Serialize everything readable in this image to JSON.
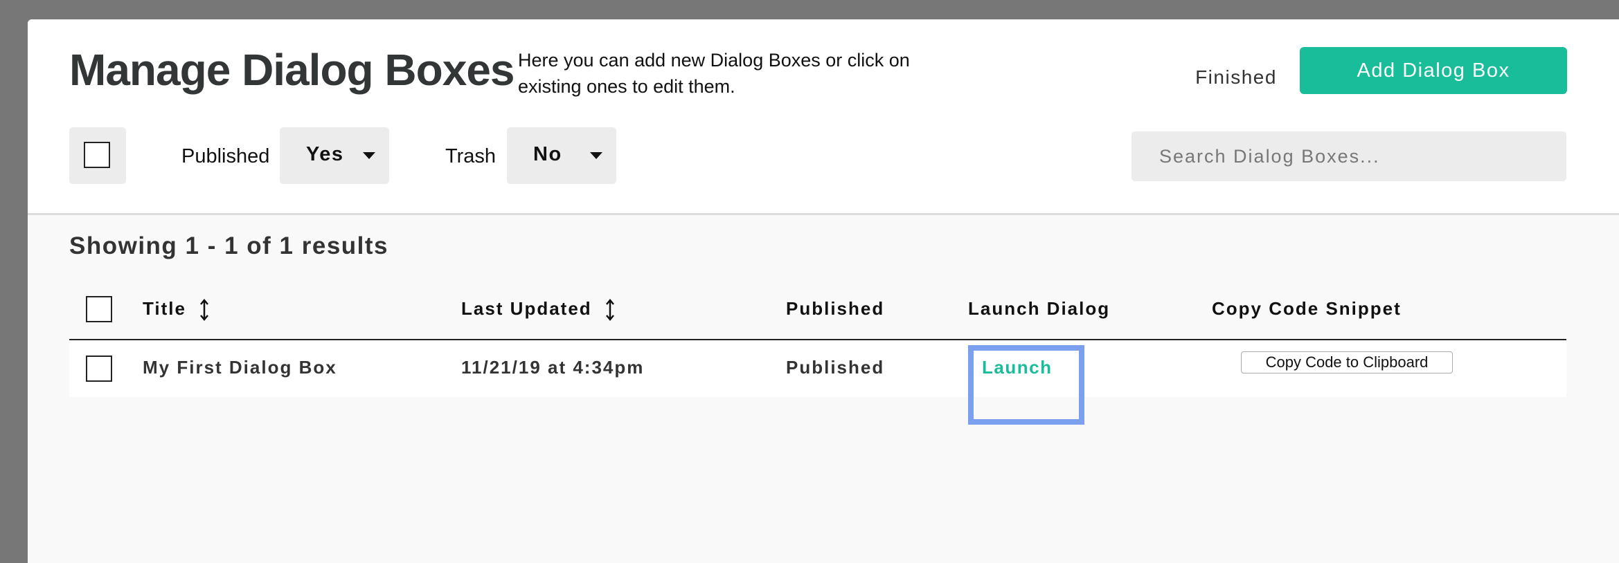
{
  "header": {
    "title": "Manage Dialog Boxes",
    "description": "Here you can add new Dialog Boxes or click on existing ones to edit them.",
    "finished_label": "Finished",
    "add_label": "Add Dialog Box"
  },
  "filters": {
    "published_label": "Published",
    "published_value": "Yes",
    "trash_label": "Trash",
    "trash_value": "No",
    "search_placeholder": "Search Dialog Boxes..."
  },
  "results": {
    "summary": "Showing 1 - 1 of 1 results"
  },
  "table": {
    "columns": [
      "Title",
      "Last Updated",
      "Published",
      "Launch Dialog",
      "Copy Code Snippet"
    ],
    "rows": [
      {
        "title": "My First Dialog Box",
        "last_updated": "11/21/19 at 4:34pm",
        "published": "Published",
        "launch": "Launch",
        "copy": "Copy Code to Clipboard"
      }
    ]
  },
  "colors": {
    "accent": "#19bd9a",
    "highlight": "#7ba0ef",
    "backdrop": "#777777"
  },
  "icons": {
    "sort": "sort-arrows-icon",
    "dropdown": "chevron-down-icon"
  }
}
